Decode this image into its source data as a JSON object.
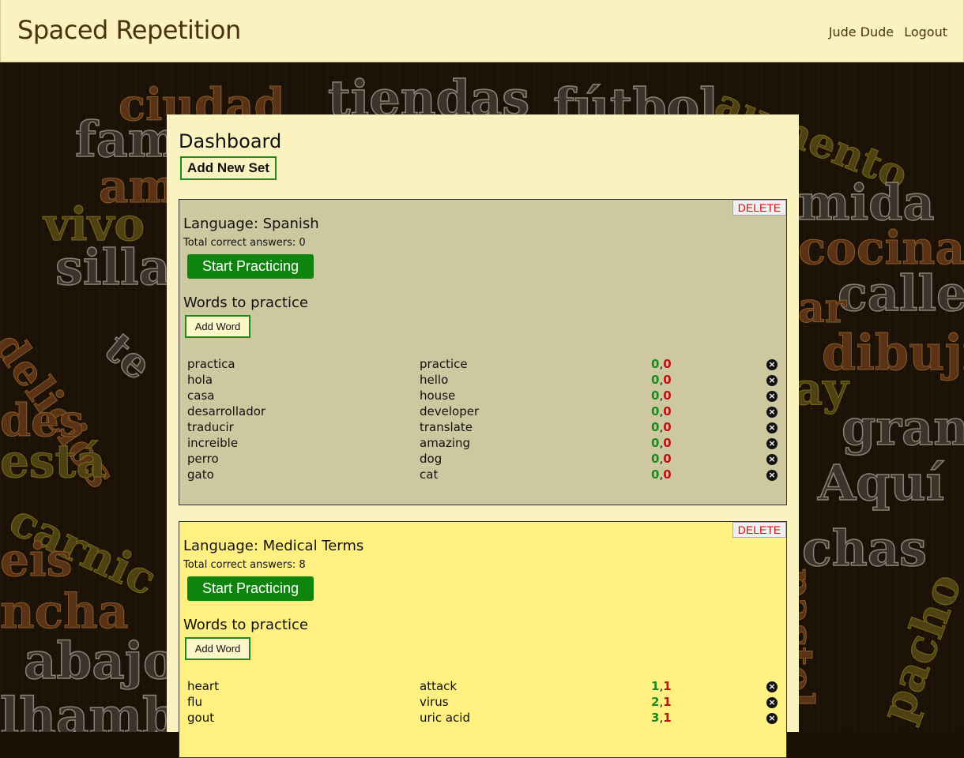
{
  "header": {
    "title": "Spaced Repetition",
    "user": "Jude Dude",
    "logout": "Logout"
  },
  "background_words": [
    "ciudad",
    "tiendas",
    "fútbol",
    "aumento",
    "fam",
    "am",
    "vivo",
    "silla",
    "mida",
    "cocina",
    "calle",
    "dibujin",
    "gran",
    "Aquí",
    "chas",
    "pacho",
    "delicios",
    "está",
    "carnic",
    "eis",
    "ncha",
    "abajo",
    "lhamb",
    "pastel",
    "ay",
    "ar",
    "des",
    "te"
  ],
  "dashboard": {
    "title": "Dashboard",
    "add_set_label": "Add New Set",
    "sets": [
      {
        "language_label": "Language: Spanish",
        "total_label": "Total correct answers: 0",
        "start_label": "Start Practicing",
        "words_heading": "Words to practice",
        "add_word_label": "Add Word",
        "delete_label": "DELETE",
        "words": [
          {
            "src": "practica",
            "tgt": "practice",
            "correct": "0",
            "wrong": "0"
          },
          {
            "src": "hola",
            "tgt": "hello",
            "correct": "0",
            "wrong": "0"
          },
          {
            "src": "casa",
            "tgt": "house",
            "correct": "0",
            "wrong": "0"
          },
          {
            "src": "desarrollador",
            "tgt": "developer",
            "correct": "0",
            "wrong": "0"
          },
          {
            "src": "traducir",
            "tgt": "translate",
            "correct": "0",
            "wrong": "0"
          },
          {
            "src": "increible",
            "tgt": "amazing",
            "correct": "0",
            "wrong": "0"
          },
          {
            "src": "perro",
            "tgt": "dog",
            "correct": "0",
            "wrong": "0"
          },
          {
            "src": "gato",
            "tgt": "cat",
            "correct": "0",
            "wrong": "0"
          }
        ]
      },
      {
        "language_label": "Language: Medical Terms",
        "total_label": "Total correct answers: 8",
        "start_label": "Start Practicing",
        "words_heading": "Words to practice",
        "add_word_label": "Add Word",
        "delete_label": "DELETE",
        "words": [
          {
            "src": "heart",
            "tgt": "attack",
            "correct": "1",
            "wrong": "1"
          },
          {
            "src": "flu",
            "tgt": "virus",
            "correct": "2",
            "wrong": "1"
          },
          {
            "src": "gout",
            "tgt": "uric acid",
            "correct": "3",
            "wrong": "1"
          }
        ]
      }
    ]
  },
  "colors": {
    "header_bg": "#faf3c0",
    "card1_bg": "#cdc8a0",
    "card2_bg": "#fff082",
    "accent_green": "#0f850f",
    "wrong_red": "#c01010"
  }
}
